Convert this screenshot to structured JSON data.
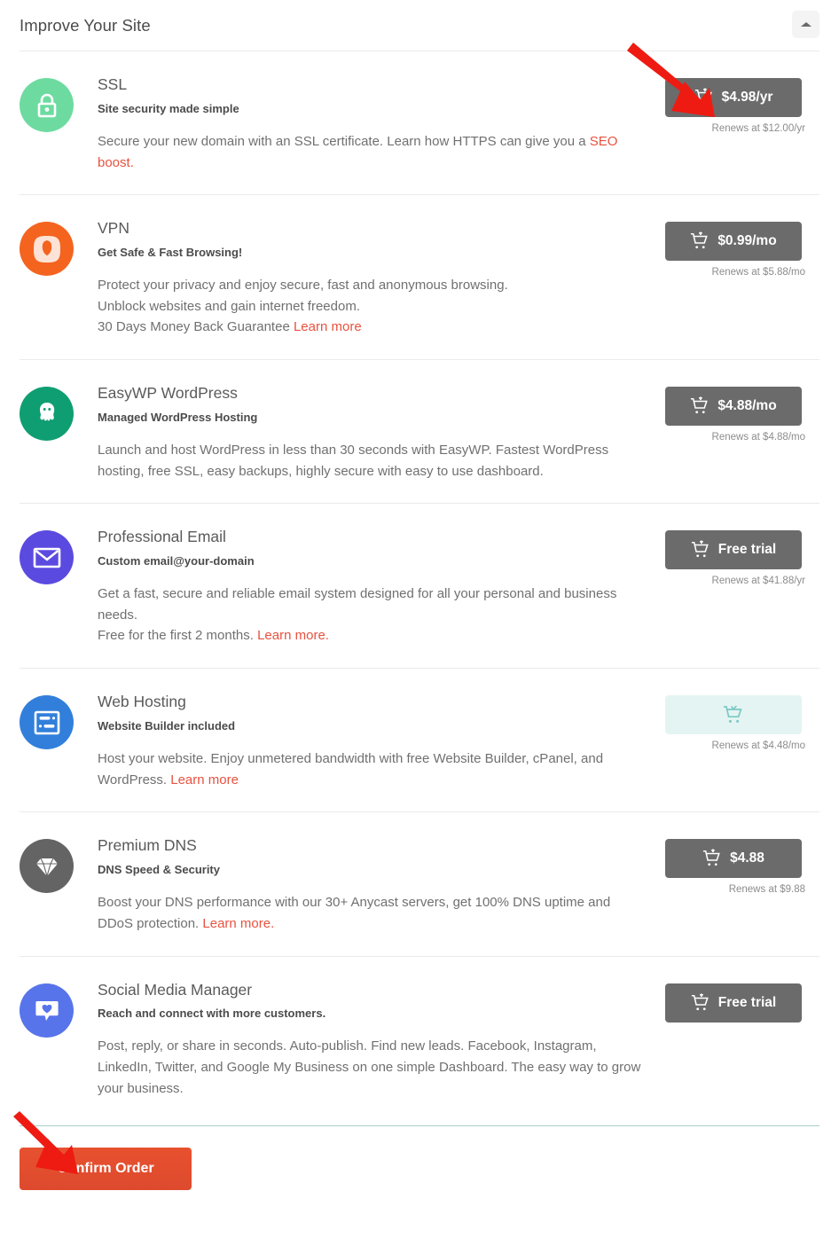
{
  "header": {
    "title": "Improve Your Site",
    "collapse_icon": "caret-up-icon"
  },
  "products": [
    {
      "id": "ssl",
      "name": "SSL",
      "tagline": "Site security made simple",
      "desc_before": "Secure your new domain with an SSL certificate. Learn how HTTPS can give you a ",
      "link": "SEO boost.",
      "desc_after": "",
      "icon": "lock-icon",
      "icon_color": "#6ddba0",
      "button_label": "$4.98/yr",
      "button_state": "add",
      "renews": "Renews at $12.00/yr"
    },
    {
      "id": "vpn",
      "name": "VPN",
      "tagline": "Get Safe & Fast Browsing!",
      "desc_before": "Protect your privacy and enjoy secure, fast and anonymous browsing.\nUnblock websites and gain internet freedom.\n30 Days Money Back Guarantee ",
      "link": "Learn more",
      "desc_after": "",
      "icon": "vpn-shield-icon",
      "icon_color": "#f4641f",
      "button_label": "$0.99/mo",
      "button_state": "add",
      "renews": "Renews at $5.88/mo"
    },
    {
      "id": "easywp",
      "name": "EasyWP WordPress",
      "tagline": "Managed WordPress Hosting",
      "desc_before": "Launch and host WordPress in less than 30 seconds with EasyWP. Fastest WordPress hosting, free SSL, easy backups, highly secure with easy to use dashboard.",
      "link": "",
      "desc_after": "",
      "icon": "octopus-icon",
      "icon_color": "#0f9e72",
      "button_label": "$4.88/mo",
      "button_state": "add",
      "renews": "Renews at $4.88/mo"
    },
    {
      "id": "email",
      "name": "Professional Email",
      "tagline": "Custom email@your-domain",
      "desc_before": "Get a fast, secure and reliable email system designed for all your personal and business needs.\nFree for the first 2 months. ",
      "link": "Learn more.",
      "desc_after": "",
      "icon": "envelope-icon",
      "icon_color": "#5b4ae0",
      "button_label": "Free trial",
      "button_state": "add",
      "renews": "Renews at $41.88/yr"
    },
    {
      "id": "webhosting",
      "name": "Web Hosting",
      "tagline": "Website Builder included",
      "desc_before": "Host your website. Enjoy unmetered bandwidth with free Website Builder, cPanel, and WordPress. ",
      "link": "Learn more",
      "desc_after": "",
      "icon": "server-icon",
      "icon_color": "#327fdb",
      "button_label": "",
      "button_state": "added",
      "renews": "Renews at $4.48/mo"
    },
    {
      "id": "premiumdns",
      "name": "Premium DNS",
      "tagline": "DNS Speed & Security",
      "desc_before": "Boost your DNS performance with our 30+ Anycast servers, get 100% DNS uptime and DDoS protection. ",
      "link": "Learn more.",
      "desc_after": "",
      "icon": "diamond-icon",
      "icon_color": "#646464",
      "button_label": "$4.88",
      "button_state": "add",
      "renews": "Renews at $9.88"
    },
    {
      "id": "socialmedia",
      "name": "Social Media Manager",
      "tagline": "Reach and connect with more customers.",
      "desc_before": "Post, reply, or share in seconds. Auto-publish. Find new leads. Facebook, Instagram, LinkedIn, Twitter, and Google My Business on one simple Dashboard. The easy way to grow your business.",
      "link": "",
      "desc_after": "",
      "icon": "heart-bubble-icon",
      "icon_color": "#5774ea",
      "button_label": "Free trial",
      "button_state": "add",
      "renews": ""
    }
  ],
  "footer": {
    "confirm_label": "Confirm Order"
  },
  "annotations": {
    "arrow_color": "#ee1b12",
    "arrow_top_target": "ssl-buy-button",
    "arrow_bottom_target": "confirm-order-button"
  },
  "colors": {
    "link": "#e8523f",
    "button": "#6b6b6b",
    "button_added_bg": "#e4f4f2",
    "button_added_fg": "#7ac9c4",
    "confirm": "#e8512f"
  }
}
